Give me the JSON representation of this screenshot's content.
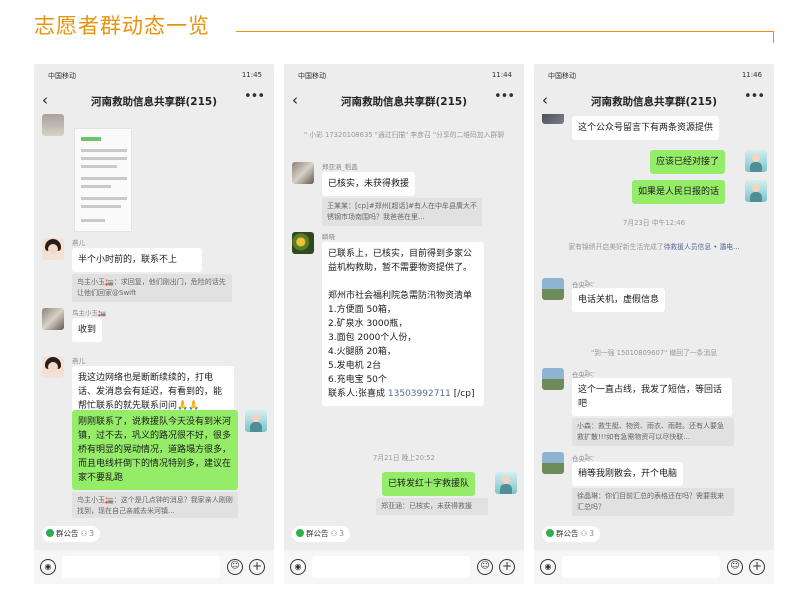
{
  "page": {
    "title": "志愿者群动态一览"
  },
  "status": {
    "carrier": "中国移动",
    "icons": "ⓝ ✻ ◎ ▤",
    "battery": "31"
  },
  "phones": [
    {
      "time": "11:45",
      "group_title": "河南救助信息共享群(215)",
      "messages": [
        {
          "nick": "燕儿",
          "text": "半个小时前的，联系不上",
          "quote": "鸟主小玉🏣：求回复，他们刚出门，危险的话先让他们回家@Swift"
        },
        {
          "nick": "鸟主小玉🏣",
          "text": "收到"
        },
        {
          "nick": "燕儿",
          "text": "我这边网络也是断断续续的，打电话、发消息会有延迟，有看到的，能帮忙联系的就先联系问问🙏🙏"
        },
        {
          "text": "刚刚联系了，说救援队今天没有到米河镇，过不去，巩义的路况很不好，很多桥有明显的晃动情况，道路塌方很多，而且电线杆倒下的情况特别多，建议在家不要乱跑",
          "quote": "鸟主小玉🏣：这个是几点钟的消息？我家亲人刚刚找到，现在自己亲戚去米河镇..."
        }
      ],
      "notice": {
        "label": "群公告",
        "count": "3"
      }
    },
    {
      "time": "11:44",
      "group_title": "河南救助信息共享群(215)",
      "system_join": {
        "pre": "\" 小彩 17320108635 \"通过扫描\" 李彦召 \"分享的二维码加入群聊"
      },
      "messages": [
        {
          "nick": "郑亚涵_稻盖",
          "text": "已核实，未获得救援",
          "quote": "王某某：[cp]#郑州[超话]#有人在中牟县廣大不锈钢市场南围吗？我爸爸在里..."
        },
        {
          "nick": "瞬晓",
          "text": "已联系上，已核实，目前得到多家公益机构救助，暂不需要物资提供了。\n\n郑州市社会福利院急需防汛物资清单\n1.方便面 50箱，\n2.矿泉水 3000瓶，\n3.面包 2000个人份，\n4.火腿肠 20箱，\n5.发电机 2台\n6.充电宝 50个\n联系人:张喜成 ",
          "phone": "13503992711",
          "tail": " [/cp]"
        },
        {
          "time_stamp": "7月21日 晚上20:52"
        },
        {
          "text": "已转发红十字救援队",
          "quote": "郑亚涵：已核实，未获得救援"
        }
      ],
      "notice": {
        "label": "群公告",
        "count": "3"
      }
    },
    {
      "time": "11:46",
      "group_title": "河南救助信息共享群(215)",
      "messages": [
        {
          "text": "这个公众号留言下有两条资源提供"
        },
        {
          "text": "应该已经对接了"
        },
        {
          "text": "如果是人民日报的话"
        },
        {
          "time_stamp": "7月23日 中午12:46"
        },
        {
          "system": "家有锦绣开启美好新生活完成了",
          "system_link": "待救援人员信息 • 灞电..."
        },
        {
          "nick": "仓央ཐིང་",
          "text": "电话关机，虚假信息"
        },
        {
          "system": "\"到一强 15010809607\" 撤回了一条消息"
        },
        {
          "nick": "仓央ཐིང་",
          "text": "这个一直占线，我发了短信，等回话吧",
          "quote": "小森：救生艇、物资、雨衣、雨鞋。还有人要急救扩散!!!如有急需物资可以尽快联..."
        },
        {
          "nick": "仓央ཐིང་",
          "text": "稍等我刚散会，开个电脑",
          "quote": "徐晶琳：你们目前汇总的表格还在吗？需要我来汇总吗？"
        }
      ],
      "notice": {
        "label": "群公告",
        "count": "3"
      }
    }
  ],
  "colors": {
    "accent": "#e8930c",
    "bubble_self": "#95ec69",
    "bubble_other": "#ffffff",
    "chat_bg": "#ededed",
    "link": "#576b95"
  },
  "icons": [
    "back-arrow-icon",
    "more-dots-icon",
    "voice-icon",
    "emoji-icon",
    "plus-icon",
    "notice-dot-icon",
    "member-icon"
  ]
}
